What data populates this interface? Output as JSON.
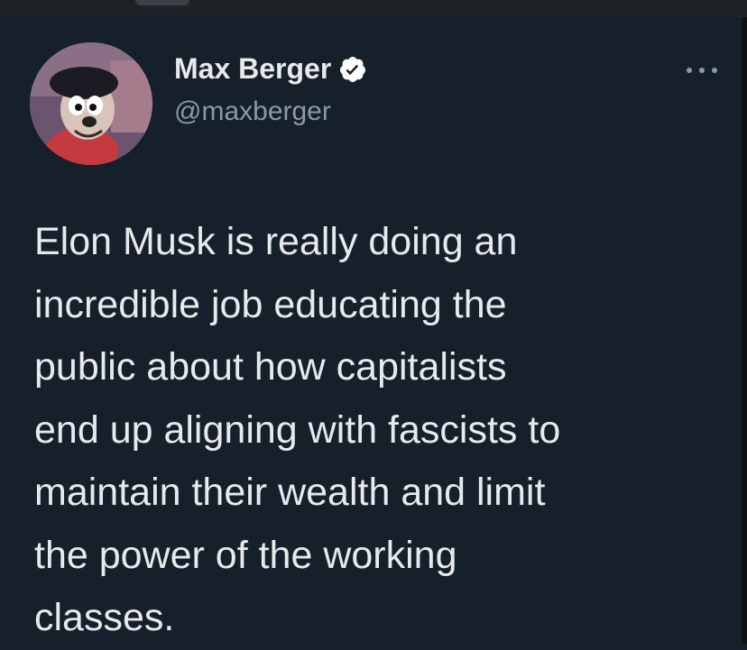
{
  "tweet": {
    "author_name": "Max Berger",
    "author_handle": "@maxberger",
    "verified_icon": "verified-badge-icon",
    "avatar_icon": "avatar-image",
    "more_icon": "more-options-icon",
    "text_lines": [
      "Elon Musk is really doing an",
      "incredible job educating the",
      "public about how capitalists",
      "end up aligning with fascists to",
      "maintain their wealth and limit",
      "the power of the working",
      "classes."
    ]
  },
  "colors": {
    "background": "#15202b",
    "text_primary": "#e7e9ea",
    "text_secondary": "#8b98a5",
    "verified_badge": "#ffffff"
  }
}
